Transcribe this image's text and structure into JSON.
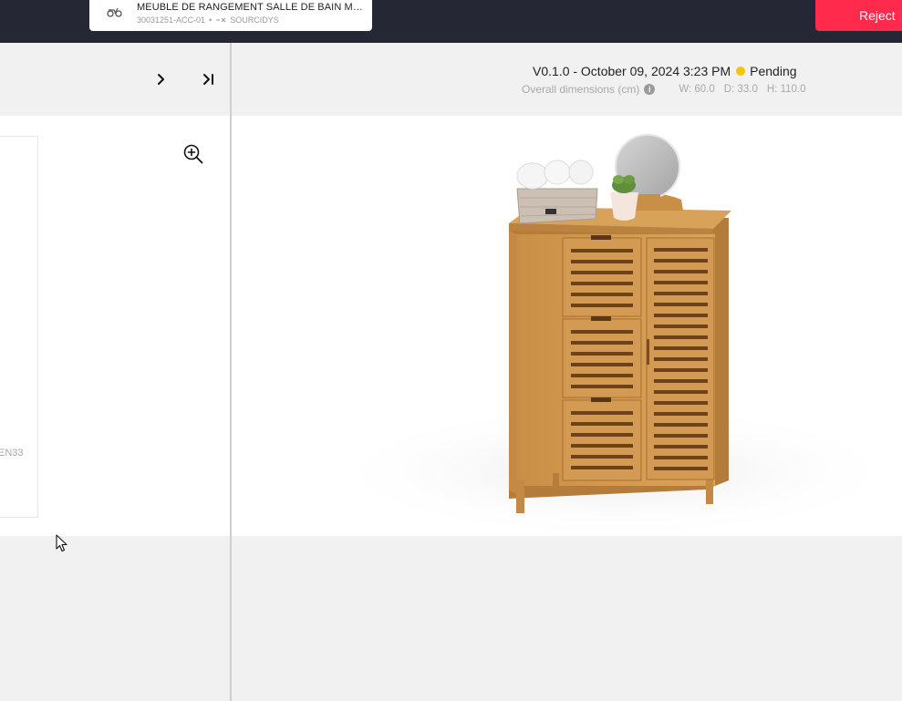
{
  "topbar": {
    "product_title": "MEUBLE DE RANGEMENT SALLE DE BAIN MAYOTTE",
    "product_ref": "30031251-ACC-01",
    "separator": "•",
    "brand": "SOURCIDYS",
    "reject_label": "Reject",
    "accent_color": "#ff2a4c"
  },
  "left_panel": {
    "thumbnail_code": "EN33",
    "icons": [
      "chevron-right-icon",
      "skip-to-end-icon",
      "zoom-in-icon"
    ]
  },
  "right_panel": {
    "version_label": "V0.1.0 - October 09, 2024 3:23 PM",
    "status_label": "Pending",
    "status_color": "#f5c600",
    "dimensions_label": "Overall dimensions (cm)",
    "width": "W: 60.0",
    "depth": "D: 33.0",
    "height": "H: 110.0"
  }
}
